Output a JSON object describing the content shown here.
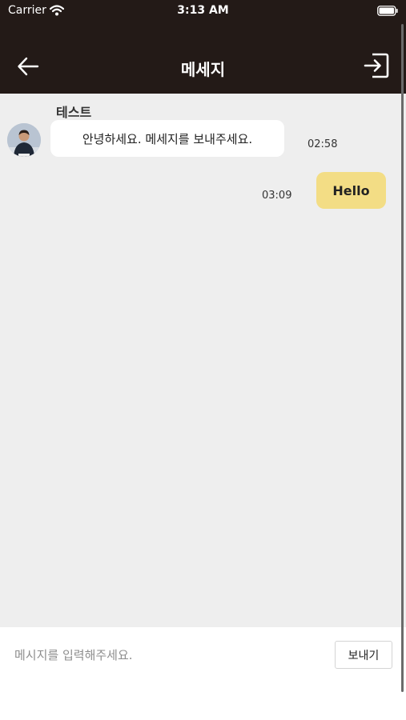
{
  "status_bar": {
    "carrier": "Carrier",
    "time": "3:13 AM",
    "wifi_icon": "wifi-icon",
    "battery_icon": "battery-icon"
  },
  "nav": {
    "title": "메세지",
    "back_icon": "arrow-left-icon",
    "exit_icon": "sign-in-icon"
  },
  "chat": {
    "sender_name": "테스트",
    "messages": [
      {
        "direction": "incoming",
        "text": "안녕하세요. 메세지를 보내주세요.",
        "time": "02:58"
      },
      {
        "direction": "outgoing",
        "text": "Hello",
        "time": "03:09"
      }
    ]
  },
  "composer": {
    "placeholder": "메시지를 입력해주세요.",
    "value": "",
    "send_label": "보내기"
  },
  "colors": {
    "header_bg": "#231a17",
    "chat_bg": "#eeeeee",
    "incoming_bubble": "#ffffff",
    "outgoing_bubble": "#f3dd85"
  }
}
